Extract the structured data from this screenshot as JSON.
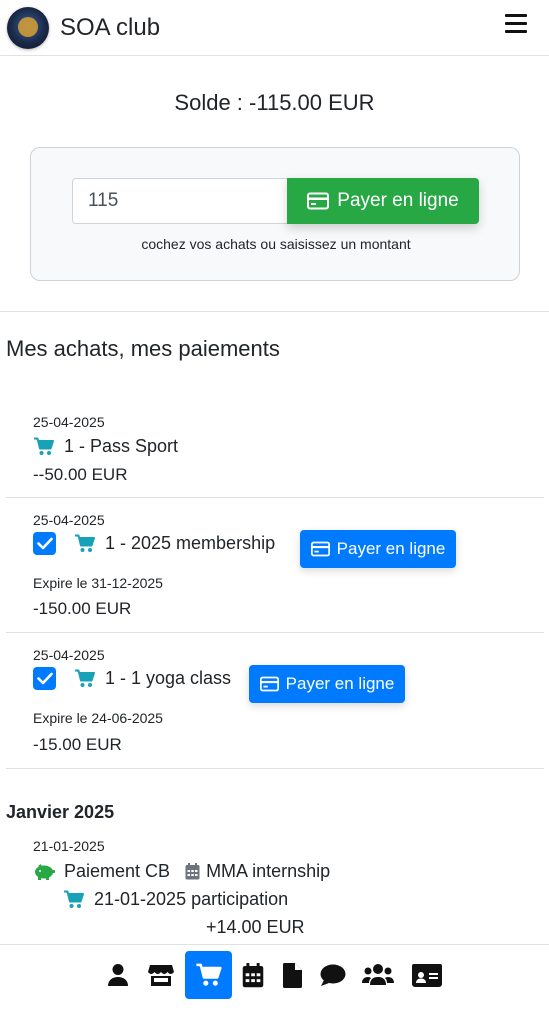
{
  "app": {
    "name": "SOA club"
  },
  "balance": {
    "text": "Solde : -115.00 EUR"
  },
  "payment": {
    "amount_value": "115",
    "pay_label": "Payer en ligne",
    "hint": "cochez vos achats ou saisissez un montant"
  },
  "purchases": {
    "title": "Mes achats, mes paiements",
    "items": [
      {
        "date": "25-04-2025",
        "label": "1 - Pass Sport",
        "amount": "--50.00 EUR"
      },
      {
        "date": "25-04-2025",
        "label": "1 - 2025 membership",
        "expire": "Expire le 31-12-2025",
        "amount": "-150.00 EUR",
        "pay_label": "Payer en ligne",
        "checked": true
      },
      {
        "date": "25-04-2025",
        "label": "1 - 1 yoga class",
        "expire": "Expire le 24-06-2025",
        "amount": "-15.00 EUR",
        "pay_label": "Payer en ligne",
        "checked": true
      }
    ]
  },
  "history": {
    "month": "Janvier 2025",
    "date": "21-01-2025",
    "method": "Paiement CB",
    "event": "MMA internship",
    "participation": "21-01-2025 participation",
    "amount": "+14.00 EUR"
  },
  "nav": {
    "items": [
      "user-icon",
      "store-icon",
      "cart-icon",
      "calendar-icon",
      "document-icon",
      "chat-icon",
      "users-icon",
      "id-card-icon"
    ],
    "active": "cart-icon"
  },
  "colors": {
    "primary": "#007bff",
    "success": "#28a745",
    "cart_teal": "#17a2b8",
    "piggy_green": "#28a745"
  }
}
